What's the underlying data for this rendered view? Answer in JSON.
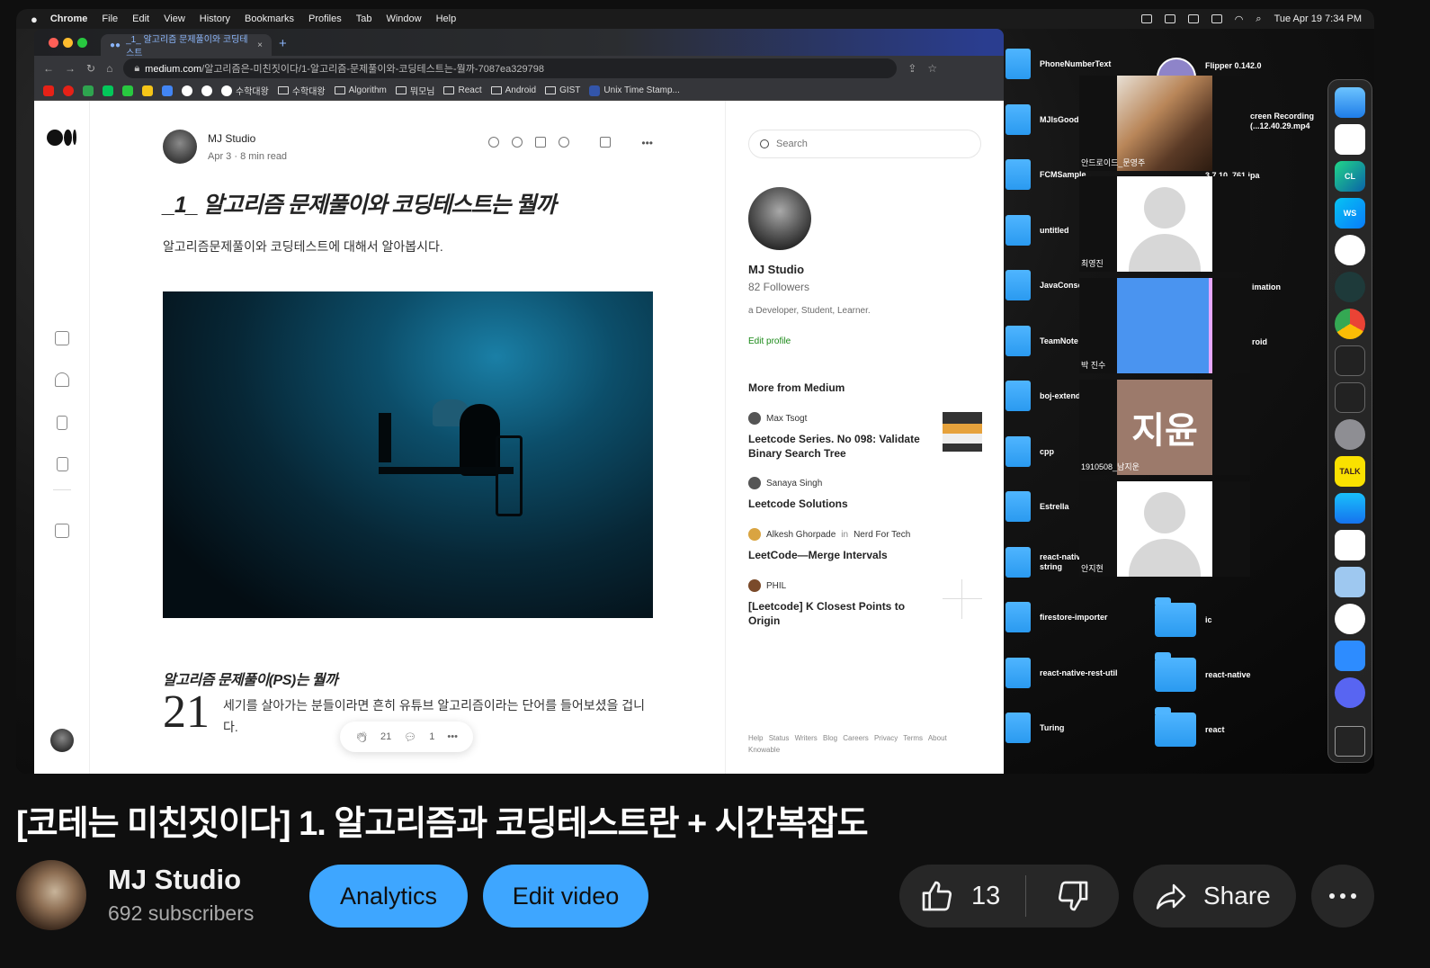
{
  "menubar": {
    "app": "Chrome",
    "menus": [
      "File",
      "Edit",
      "View",
      "History",
      "Bookmarks",
      "Profiles",
      "Tab",
      "Window",
      "Help"
    ],
    "datetime": "Tue Apr 19  7:34 PM"
  },
  "browser": {
    "tab_title": "_1_ 알고리즘 문제풀이와 코딩테스트",
    "tab_close": "×",
    "new_tab": "+",
    "url_host": "medium.com",
    "url_path": "/알고리즘은-미친짓이다/1-알고리즘-문제풀이와-코딩테스트는-뭘까-7087ea329798",
    "bookmarks": [
      "수학대왕",
      "수학대왕",
      "Algorithm",
      "뭐모님",
      "React",
      "Android",
      "GIST",
      "Unix Time Stamp..."
    ]
  },
  "article": {
    "author": "MJ Studio",
    "date": "Apr 3",
    "read_time": "8 min read",
    "title": "_1_ 알고리즘 문제풀이와 코딩테스트는 뭘까",
    "subtitle": "알고리즘문제풀이와 코딩테스트에 대해서 알아봅시다.",
    "section_heading": "알고리즘 문제풀이(PS)는 뭘까",
    "dropcap": "21",
    "body": "세기를 살아가는 분들이라면 흔히 유튜브 알고리즘이라는 단어를 들어보셨을 겁니다.",
    "claps": "21",
    "responses": "1",
    "more": "•••"
  },
  "sidebar": {
    "search_placeholder": "Search",
    "profile_name": "MJ Studio",
    "followers": "82 Followers",
    "bio": "a Developer, Student, Learner.",
    "edit_profile": "Edit profile",
    "more_heading": "More from Medium",
    "recommendations": [
      {
        "author": "Max Tsogt",
        "publication": "",
        "title": "Leetcode Series. No 098: Validate Binary Search Tree"
      },
      {
        "author": "Sanaya Singh",
        "publication": "",
        "title": "Leetcode Solutions"
      },
      {
        "author": "Alkesh Ghorpade",
        "in": "in",
        "publication": "Nerd For Tech",
        "title": "LeetCode—Merge Intervals"
      },
      {
        "author": "PHIL",
        "publication": "",
        "title": "[Leetcode] K Closest Points to Origin"
      }
    ],
    "footer_links": [
      "Help",
      "Status",
      "Writers",
      "Blog",
      "Careers",
      "Privacy",
      "Terms",
      "About",
      "Knowable"
    ]
  },
  "desktop": {
    "left_column": [
      "PhoneNumberText",
      "MJIsGood",
      "FCMSample",
      "untitled",
      "JavaConsol",
      "TeamNote",
      "boj-extende",
      "cpp",
      "Estrella",
      "react-native string",
      "firestore-importer",
      "react-native-rest-util",
      "Turing"
    ],
    "right_column": [
      "Flipper 0.142.0",
      "creen Recording (...12.40.29.mp4",
      "3.7.10_761.ipa",
      "imation",
      "roid",
      "ic",
      "react-native",
      "react"
    ],
    "participants": [
      "안드로이드_문영주",
      "최영진",
      "박 진수",
      "1910508_남지운",
      "안지현"
    ],
    "participant_avatar_text": "지윤"
  },
  "dock": {
    "labels": [
      "CL",
      "WS",
      "TALK"
    ]
  },
  "video": {
    "title": "[코테는 미친짓이다] 1. 알고리즘과 코딩테스트란 + 시간복잡도",
    "channel": "MJ Studio",
    "subscribers": "692 subscribers",
    "analytics": "Analytics",
    "edit_video": "Edit video",
    "likes": "13",
    "share": "Share"
  },
  "colors": {
    "accent_blue": "#3ea6ff",
    "medium_green": "#1a8917",
    "pill_dark": "#272727"
  }
}
